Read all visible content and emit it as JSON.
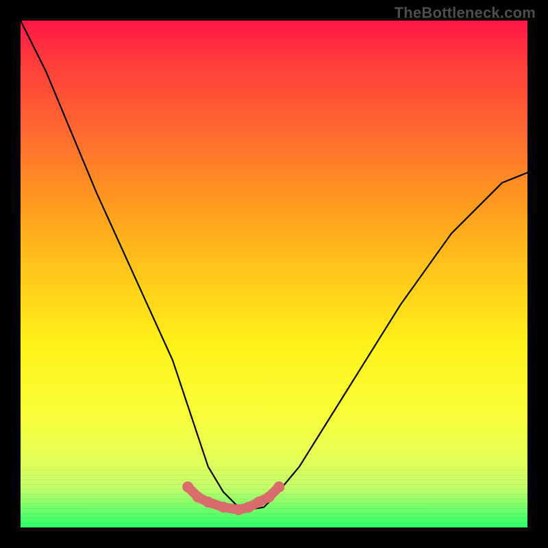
{
  "watermark": {
    "text": "TheBottleneck.com"
  },
  "chart_data": {
    "type": "line",
    "title": "",
    "xlabel": "",
    "ylabel": "",
    "xlim": [
      0,
      100
    ],
    "ylim": [
      0,
      100
    ],
    "grid": false,
    "legend": false,
    "series": [
      {
        "name": "curve",
        "color": "#000000",
        "x": [
          0,
          5,
          10,
          15,
          20,
          25,
          30,
          35,
          37,
          40,
          43,
          45,
          48,
          50,
          55,
          60,
          65,
          70,
          75,
          80,
          85,
          90,
          95,
          100
        ],
        "y": [
          100,
          90,
          78,
          66,
          55,
          44,
          33,
          18,
          12,
          7,
          4,
          3.5,
          4,
          6,
          12,
          20,
          28,
          36,
          44,
          51,
          58,
          63,
          68,
          70
        ]
      },
      {
        "name": "highlight-band",
        "color": "#d86b6b",
        "x": [
          33,
          35,
          37,
          40,
          43,
          45,
          47,
          49,
          51
        ],
        "y": [
          8,
          6,
          5,
          4,
          3.5,
          4,
          5,
          6,
          8
        ]
      }
    ],
    "gradient_stops": [
      {
        "pos": 0.0,
        "color": "#ff1747"
      },
      {
        "pos": 0.08,
        "color": "#ff3b3b"
      },
      {
        "pos": 0.22,
        "color": "#ff6a2f"
      },
      {
        "pos": 0.36,
        "color": "#ff9a1f"
      },
      {
        "pos": 0.5,
        "color": "#ffc81a"
      },
      {
        "pos": 0.64,
        "color": "#fff21a"
      },
      {
        "pos": 0.78,
        "color": "#f8ff3a"
      },
      {
        "pos": 0.86,
        "color": "#e6ff55"
      },
      {
        "pos": 0.92,
        "color": "#c4ff6a"
      },
      {
        "pos": 1.0,
        "color": "#2dff6a"
      }
    ]
  }
}
